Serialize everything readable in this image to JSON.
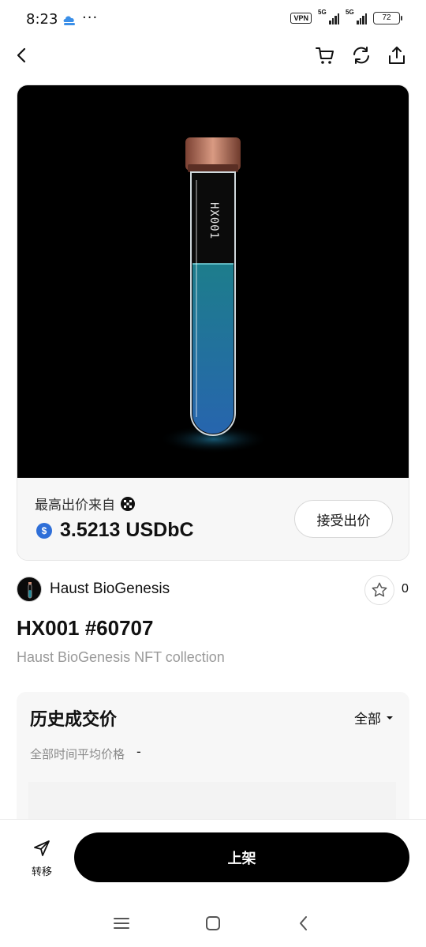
{
  "status_bar": {
    "time": "8:23",
    "dots": "···",
    "vpn": "VPN",
    "network_1": "5G",
    "network_2": "5G",
    "battery": "72"
  },
  "nav": {
    "back_icon": "chevron-left-icon",
    "cart_icon": "cart-icon",
    "refresh_icon": "refresh-icon",
    "share_icon": "share-icon"
  },
  "nft_image": {
    "tube_label": "HX001"
  },
  "offer": {
    "label": "最高出价来自",
    "price": "3.5213 USDbC",
    "currency_symbol": "$",
    "accept_button": "接受出价"
  },
  "collection": {
    "name": "Haust BioGenesis",
    "favorites": "0"
  },
  "nft": {
    "title": "HX001 #60707",
    "description": "Haust BioGenesis NFT collection"
  },
  "history": {
    "title": "历史成交价",
    "filter": "全部",
    "avg_label": "全部时间平均价格",
    "avg_value": "-"
  },
  "actions": {
    "transfer": "转移",
    "list": "上架"
  },
  "colors": {
    "accent": "#000000",
    "usdc_blue": "#2f6fd8",
    "tube_liquid": "#1aa0b8",
    "cap_copper": "#c98a72"
  }
}
